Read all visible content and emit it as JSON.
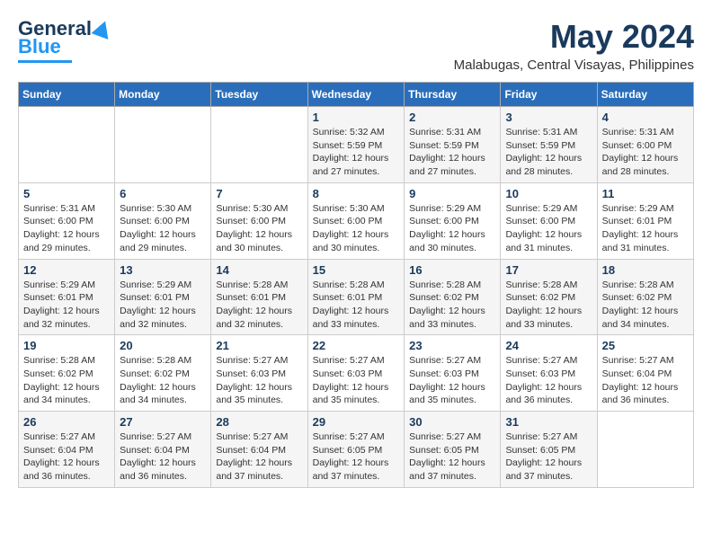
{
  "logo": {
    "line1": "General",
    "line2": "Blue"
  },
  "header": {
    "month_year": "May 2024",
    "location": "Malabugas, Central Visayas, Philippines"
  },
  "days_of_week": [
    "Sunday",
    "Monday",
    "Tuesday",
    "Wednesday",
    "Thursday",
    "Friday",
    "Saturday"
  ],
  "weeks": [
    [
      {
        "day": "",
        "info": ""
      },
      {
        "day": "",
        "info": ""
      },
      {
        "day": "",
        "info": ""
      },
      {
        "day": "1",
        "info": "Sunrise: 5:32 AM\nSunset: 5:59 PM\nDaylight: 12 hours and 27 minutes."
      },
      {
        "day": "2",
        "info": "Sunrise: 5:31 AM\nSunset: 5:59 PM\nDaylight: 12 hours and 27 minutes."
      },
      {
        "day": "3",
        "info": "Sunrise: 5:31 AM\nSunset: 5:59 PM\nDaylight: 12 hours and 28 minutes."
      },
      {
        "day": "4",
        "info": "Sunrise: 5:31 AM\nSunset: 6:00 PM\nDaylight: 12 hours and 28 minutes."
      }
    ],
    [
      {
        "day": "5",
        "info": "Sunrise: 5:31 AM\nSunset: 6:00 PM\nDaylight: 12 hours and 29 minutes."
      },
      {
        "day": "6",
        "info": "Sunrise: 5:30 AM\nSunset: 6:00 PM\nDaylight: 12 hours and 29 minutes."
      },
      {
        "day": "7",
        "info": "Sunrise: 5:30 AM\nSunset: 6:00 PM\nDaylight: 12 hours and 30 minutes."
      },
      {
        "day": "8",
        "info": "Sunrise: 5:30 AM\nSunset: 6:00 PM\nDaylight: 12 hours and 30 minutes."
      },
      {
        "day": "9",
        "info": "Sunrise: 5:29 AM\nSunset: 6:00 PM\nDaylight: 12 hours and 30 minutes."
      },
      {
        "day": "10",
        "info": "Sunrise: 5:29 AM\nSunset: 6:00 PM\nDaylight: 12 hours and 31 minutes."
      },
      {
        "day": "11",
        "info": "Sunrise: 5:29 AM\nSunset: 6:01 PM\nDaylight: 12 hours and 31 minutes."
      }
    ],
    [
      {
        "day": "12",
        "info": "Sunrise: 5:29 AM\nSunset: 6:01 PM\nDaylight: 12 hours and 32 minutes."
      },
      {
        "day": "13",
        "info": "Sunrise: 5:29 AM\nSunset: 6:01 PM\nDaylight: 12 hours and 32 minutes."
      },
      {
        "day": "14",
        "info": "Sunrise: 5:28 AM\nSunset: 6:01 PM\nDaylight: 12 hours and 32 minutes."
      },
      {
        "day": "15",
        "info": "Sunrise: 5:28 AM\nSunset: 6:01 PM\nDaylight: 12 hours and 33 minutes."
      },
      {
        "day": "16",
        "info": "Sunrise: 5:28 AM\nSunset: 6:02 PM\nDaylight: 12 hours and 33 minutes."
      },
      {
        "day": "17",
        "info": "Sunrise: 5:28 AM\nSunset: 6:02 PM\nDaylight: 12 hours and 33 minutes."
      },
      {
        "day": "18",
        "info": "Sunrise: 5:28 AM\nSunset: 6:02 PM\nDaylight: 12 hours and 34 minutes."
      }
    ],
    [
      {
        "day": "19",
        "info": "Sunrise: 5:28 AM\nSunset: 6:02 PM\nDaylight: 12 hours and 34 minutes."
      },
      {
        "day": "20",
        "info": "Sunrise: 5:28 AM\nSunset: 6:02 PM\nDaylight: 12 hours and 34 minutes."
      },
      {
        "day": "21",
        "info": "Sunrise: 5:27 AM\nSunset: 6:03 PM\nDaylight: 12 hours and 35 minutes."
      },
      {
        "day": "22",
        "info": "Sunrise: 5:27 AM\nSunset: 6:03 PM\nDaylight: 12 hours and 35 minutes."
      },
      {
        "day": "23",
        "info": "Sunrise: 5:27 AM\nSunset: 6:03 PM\nDaylight: 12 hours and 35 minutes."
      },
      {
        "day": "24",
        "info": "Sunrise: 5:27 AM\nSunset: 6:03 PM\nDaylight: 12 hours and 36 minutes."
      },
      {
        "day": "25",
        "info": "Sunrise: 5:27 AM\nSunset: 6:04 PM\nDaylight: 12 hours and 36 minutes."
      }
    ],
    [
      {
        "day": "26",
        "info": "Sunrise: 5:27 AM\nSunset: 6:04 PM\nDaylight: 12 hours and 36 minutes."
      },
      {
        "day": "27",
        "info": "Sunrise: 5:27 AM\nSunset: 6:04 PM\nDaylight: 12 hours and 36 minutes."
      },
      {
        "day": "28",
        "info": "Sunrise: 5:27 AM\nSunset: 6:04 PM\nDaylight: 12 hours and 37 minutes."
      },
      {
        "day": "29",
        "info": "Sunrise: 5:27 AM\nSunset: 6:05 PM\nDaylight: 12 hours and 37 minutes."
      },
      {
        "day": "30",
        "info": "Sunrise: 5:27 AM\nSunset: 6:05 PM\nDaylight: 12 hours and 37 minutes."
      },
      {
        "day": "31",
        "info": "Sunrise: 5:27 AM\nSunset: 6:05 PM\nDaylight: 12 hours and 37 minutes."
      },
      {
        "day": "",
        "info": ""
      }
    ]
  ]
}
